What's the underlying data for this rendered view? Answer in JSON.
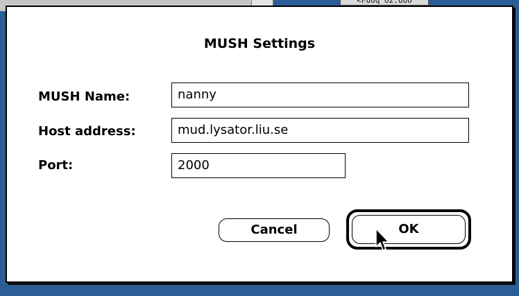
{
  "background": {
    "window_label": "<Fuoq o2.uoo"
  },
  "dialog": {
    "title": "MUSH Settings",
    "fields": [
      {
        "label": "MUSH Name:",
        "value": "nanny"
      },
      {
        "label": "Host address:",
        "value": "mud.lysator.liu.se"
      },
      {
        "label": "Port:",
        "value": "2000"
      }
    ],
    "buttons": {
      "cancel": "Cancel",
      "ok": "OK"
    }
  },
  "colors": {
    "desktop": "#2b5d97",
    "dialog_bg": "#ffffff",
    "border": "#000000"
  },
  "icons": {
    "pointer": "arrow-cursor-icon"
  }
}
